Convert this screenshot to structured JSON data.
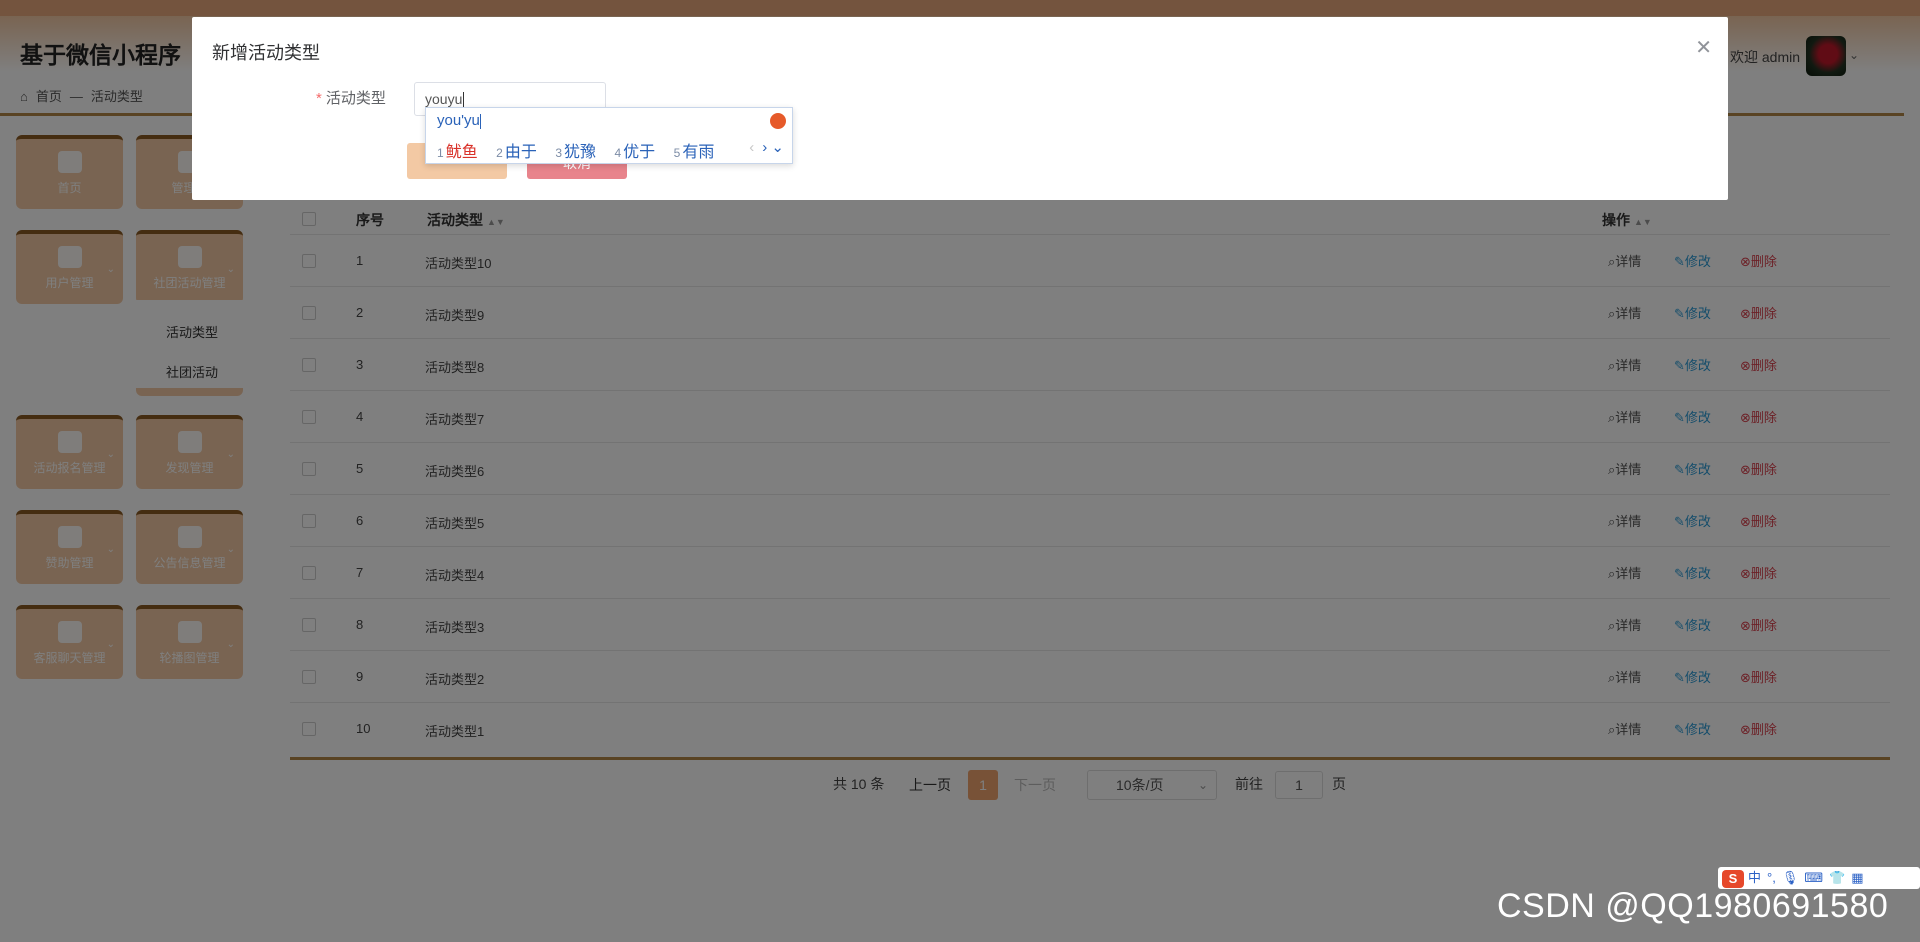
{
  "header": {
    "app_title": "基于微信小程序",
    "welcome": "欢迎 admin",
    "avatar_menu_icon": "chevron-down-icon"
  },
  "breadcrumb": {
    "home": "首页",
    "separator": "—",
    "current": "活动类型"
  },
  "sidebar": {
    "tiles": [
      {
        "label": "首页",
        "icon": "home-icon"
      },
      {
        "label": "管理员",
        "icon": "admin-icon"
      },
      {
        "label": "用户管理",
        "icon": "user-icon"
      },
      {
        "label": "社团活动管理",
        "icon": "book-icon"
      },
      {
        "label": "活动报名管理",
        "icon": "folder-icon"
      },
      {
        "label": "发现管理",
        "icon": "grid-icon"
      },
      {
        "label": "赞助管理",
        "icon": "briefcase-icon"
      },
      {
        "label": "公告信息管理",
        "icon": "chat-icon"
      },
      {
        "label": "客服聊天管理",
        "icon": "building-icon"
      },
      {
        "label": "轮播图管理",
        "icon": "image-icon"
      }
    ],
    "submenu": [
      "活动类型",
      "社团活动"
    ]
  },
  "table": {
    "headers": {
      "index": "序号",
      "type": "活动类型",
      "actions": "操作"
    },
    "rows": [
      {
        "num": "1",
        "name": "活动类型10"
      },
      {
        "num": "2",
        "name": "活动类型9"
      },
      {
        "num": "3",
        "name": "活动类型8"
      },
      {
        "num": "4",
        "name": "活动类型7"
      },
      {
        "num": "5",
        "name": "活动类型6"
      },
      {
        "num": "6",
        "name": "活动类型5"
      },
      {
        "num": "7",
        "name": "活动类型4"
      },
      {
        "num": "8",
        "name": "活动类型3"
      },
      {
        "num": "9",
        "name": "活动类型2"
      },
      {
        "num": "10",
        "name": "活动类型1"
      }
    ],
    "actions": {
      "detail": "详情",
      "edit": "修改",
      "delete": "删除"
    }
  },
  "pagination": {
    "total": "共 10 条",
    "prev": "上一页",
    "current_page": "1",
    "next": "下一页",
    "page_size": "10条/页",
    "goto_label": "前往",
    "goto_value": "1",
    "goto_suffix": "页"
  },
  "dialog": {
    "title": "新增活动类型",
    "close_icon": "close-icon",
    "field_label": "活动类型",
    "required_mark": "*",
    "field_value": "youyu",
    "cancel_label": "取消"
  },
  "ime": {
    "composition": "you'yu",
    "candidates": [
      {
        "n": "1",
        "text": "鱿鱼"
      },
      {
        "n": "2",
        "text": "由于"
      },
      {
        "n": "3",
        "text": "犹豫"
      },
      {
        "n": "4",
        "text": "优于"
      },
      {
        "n": "5",
        "text": "有雨"
      }
    ]
  },
  "tray": {
    "ime_mode": "中",
    "logo": "S"
  },
  "watermark": "CSDN @QQ1980691580",
  "colors": {
    "accent": "#f0a56e",
    "tile": "#f3c9a4",
    "bar": "#b28647",
    "edit": "#2b9bd6",
    "delete": "#d9404d"
  }
}
